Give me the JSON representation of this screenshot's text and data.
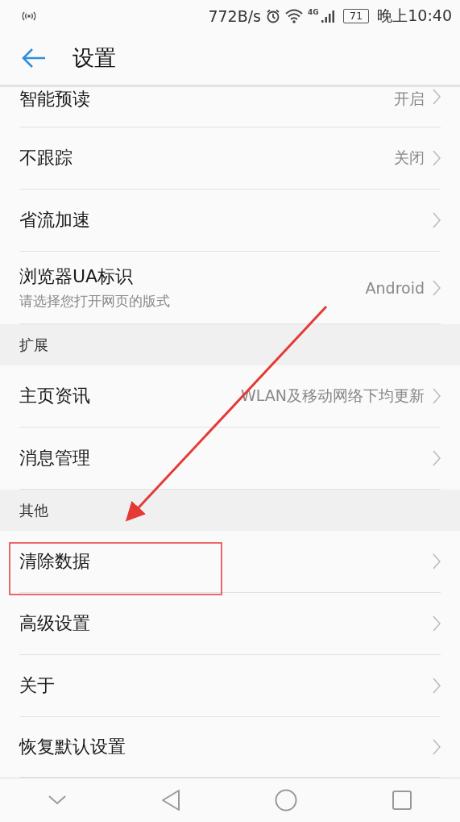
{
  "status_bar": {
    "network_speed": "772B/s",
    "network_type": "4G",
    "battery": "71",
    "time": "晚上10:40"
  },
  "header": {
    "title": "设置"
  },
  "items": [
    {
      "kind": "row",
      "title": "智能预读",
      "value": "开启",
      "cut": true
    },
    {
      "kind": "row",
      "title": "不跟踪",
      "value": "关闭"
    },
    {
      "kind": "row",
      "title": "省流加速"
    },
    {
      "kind": "row",
      "title": "浏览器UA标识",
      "subtitle": "请选择您打开网页的版式",
      "value": "Android"
    },
    {
      "kind": "section",
      "title": "扩展"
    },
    {
      "kind": "row",
      "title": "主页资讯",
      "value": "WLAN及移动网络下均更新"
    },
    {
      "kind": "row",
      "title": "消息管理"
    },
    {
      "kind": "section",
      "title": "其他"
    },
    {
      "kind": "row",
      "title": "清除数据"
    },
    {
      "kind": "row",
      "title": "高级设置"
    },
    {
      "kind": "row",
      "title": "关于"
    },
    {
      "kind": "row",
      "title": "恢复默认设置"
    }
  ]
}
